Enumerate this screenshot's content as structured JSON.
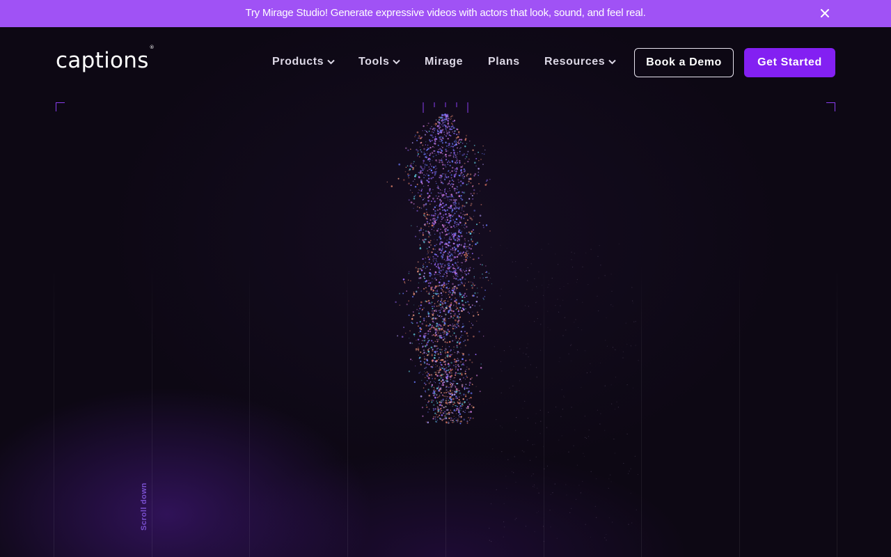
{
  "banner": {
    "text": "Try Mirage Studio! Generate expressive videos with actors that look, sound, and feel real.",
    "close_icon": "close-icon",
    "background": "#a052f5"
  },
  "nav": {
    "logo": "captions",
    "logo_mark": "®",
    "items": [
      {
        "label": "Products",
        "dropdown": true
      },
      {
        "label": "Tools",
        "dropdown": true
      },
      {
        "label": "Mirage",
        "dropdown": false
      },
      {
        "label": "Plans",
        "dropdown": false
      },
      {
        "label": "Resources",
        "dropdown": true
      }
    ],
    "book_demo_label": "Book a Demo",
    "get_started_label": "Get Started",
    "accent": "#8320f2"
  },
  "hero": {
    "scroll_label": "Scroll down",
    "visual": "particle-figure"
  }
}
